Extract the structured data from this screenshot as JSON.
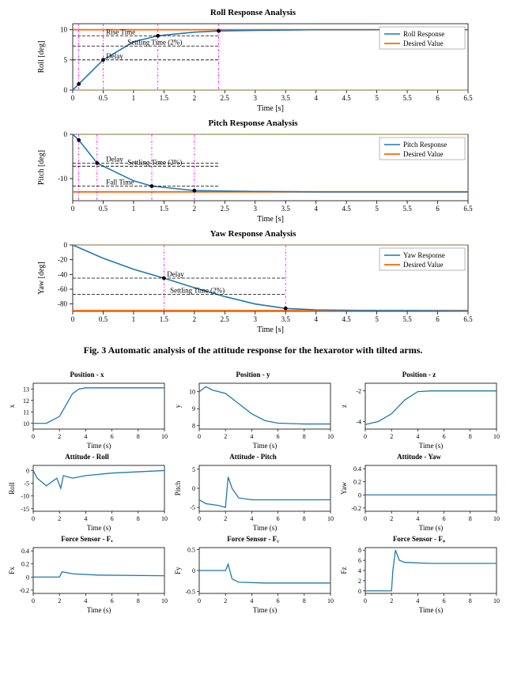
{
  "caption": "Fig. 3   Automatic analysis of the attitude response for the hexarotor with tilted arms.",
  "top_charts": [
    {
      "title": "Roll Response Analysis",
      "ylabel": "Roll [deg]",
      "xlabel": "Time [s]",
      "legend": [
        "Roll Response",
        "Desired Value"
      ],
      "annotations": [
        "Rise Time",
        "Delay",
        "Settling Time (2%)"
      ]
    },
    {
      "title": "Pitch Response Analysis",
      "ylabel": "Pitch [deg]",
      "xlabel": "Time [s]",
      "legend": [
        "Pitch Response",
        "Desired Value"
      ],
      "annotations": [
        "Delay",
        "Settling Time (2%)",
        "Fall Time"
      ]
    },
    {
      "title": "Yaw Response Analysis",
      "ylabel": "Yaw [deg]",
      "xlabel": "Time [s]",
      "legend": [
        "Yaw Response",
        "Desired Value"
      ],
      "annotations": [
        "Delay",
        "Settling Time (2%)"
      ]
    }
  ],
  "small_charts": [
    {
      "title": "Position - x",
      "ylabel": "x",
      "xlabel": "Time (s)"
    },
    {
      "title": "Position - y",
      "ylabel": "y",
      "xlabel": "Time (s)"
    },
    {
      "title": "Position - z",
      "ylabel": "z",
      "xlabel": "Time (s)"
    },
    {
      "title": "Attitude - Roll",
      "ylabel": "Roll",
      "xlabel": "Time (s)"
    },
    {
      "title": "Attitude - Pitch",
      "ylabel": "Pitch",
      "xlabel": "Time (s)"
    },
    {
      "title": "Attitude - Yaw",
      "ylabel": "Yaw",
      "xlabel": "Time (s)"
    },
    {
      "title": "Force Sensor - Fₓ",
      "ylabel": "Fₓ",
      "xlabel": "Time (s)"
    },
    {
      "title": "Force Sensor - Fᵧ",
      "ylabel": "Fᵧ",
      "xlabel": "Time (s)"
    },
    {
      "title": "Force Sensor - Fᵩ",
      "ylabel": "Fᵩ",
      "xlabel": "Time (s)"
    }
  ],
  "chart_data": [
    {
      "name": "Roll Response Analysis",
      "type": "line",
      "xlabel": "Time [s]",
      "ylabel": "Roll [deg]",
      "xlim": [
        0,
        6.5
      ],
      "ylim": [
        0,
        11
      ],
      "xticks": [
        0,
        0.5,
        1,
        1.5,
        2,
        2.5,
        3,
        3.5,
        4,
        4.5,
        5,
        5.5,
        6,
        6.5
      ],
      "yticks": [
        0,
        5,
        10
      ],
      "series": [
        {
          "name": "Roll Response",
          "x": [
            0,
            0.1,
            0.5,
            1.0,
            1.4,
            2.0,
            2.4,
            3.0,
            4.0,
            6.5
          ],
          "y": [
            0,
            1.0,
            5.0,
            8.0,
            9.0,
            9.6,
            9.8,
            9.9,
            10.0,
            10.0
          ]
        },
        {
          "name": "Desired Value",
          "x": [
            0,
            6.5
          ],
          "y": [
            10,
            10
          ]
        }
      ],
      "markers": [
        {
          "x": 0.1,
          "y": 1.0
        },
        {
          "x": 0.5,
          "y": 5.0
        },
        {
          "x": 1.4,
          "y": 9.0
        },
        {
          "x": 2.4,
          "y": 9.8
        }
      ],
      "vertical_markers_x": [
        0.1,
        0.5,
        1.4,
        2.4
      ],
      "h_annotations": [
        {
          "y": 9.0,
          "label": "Rise Time"
        },
        {
          "y": 5.0,
          "label": "Delay"
        },
        {
          "y": 7.3,
          "label": "Settling Time (2%)"
        }
      ]
    },
    {
      "name": "Pitch Response Analysis",
      "type": "line",
      "xlabel": "Time [s]",
      "ylabel": "Pitch [deg]",
      "xlim": [
        0,
        6.5
      ],
      "ylim": [
        -15,
        0
      ],
      "xticks": [
        0,
        0.5,
        1,
        1.5,
        2,
        2.5,
        3,
        3.5,
        4,
        4.5,
        5,
        5.5,
        6,
        6.5
      ],
      "yticks": [
        -10,
        0
      ],
      "series": [
        {
          "name": "Pitch Response",
          "x": [
            0,
            0.1,
            0.4,
            1.0,
            1.3,
            2.0,
            3.0,
            4.0,
            6.5
          ],
          "y": [
            0,
            -1.3,
            -6.5,
            -10.5,
            -11.7,
            -12.7,
            -12.9,
            -13.0,
            -13.0
          ]
        },
        {
          "name": "Desired Value",
          "x": [
            0,
            6.5
          ],
          "y": [
            -13,
            -13
          ]
        }
      ],
      "markers": [
        {
          "x": 0.1,
          "y": -1.3
        },
        {
          "x": 0.4,
          "y": -6.5
        },
        {
          "x": 1.3,
          "y": -11.7
        },
        {
          "x": 2.0,
          "y": -12.7
        }
      ],
      "vertical_markers_x": [
        0.1,
        0.4,
        1.3,
        2.0
      ],
      "h_annotations": [
        {
          "y": -6.5,
          "label": "Delay"
        },
        {
          "y": -7.2,
          "label": "Settling Time (2%)"
        },
        {
          "y": -11.7,
          "label": "Fall Time"
        }
      ]
    },
    {
      "name": "Yaw Response Analysis",
      "type": "line",
      "xlabel": "Time [s]",
      "ylabel": "Yaw [deg]",
      "xlim": [
        0,
        6.5
      ],
      "ylim": [
        -90,
        0
      ],
      "xticks": [
        0,
        0.5,
        1,
        1.5,
        2,
        2.5,
        3,
        3.5,
        4,
        4.5,
        5,
        5.5,
        6,
        6.5
      ],
      "yticks": [
        -80,
        -60,
        -40,
        -20,
        0
      ],
      "series": [
        {
          "name": "Yaw Response",
          "x": [
            0,
            0.5,
            1.0,
            1.5,
            2.0,
            2.5,
            3.0,
            3.5,
            4.0,
            5.0,
            6.5
          ],
          "y": [
            0,
            -18,
            -33,
            -45,
            -58,
            -70,
            -80,
            -86,
            -88,
            -89,
            -89.5
          ]
        },
        {
          "name": "Desired Value",
          "x": [
            0,
            6.5
          ],
          "y": [
            -89,
            -89
          ]
        }
      ],
      "markers": [
        {
          "x": 1.5,
          "y": -45
        },
        {
          "x": 3.5,
          "y": -86
        }
      ],
      "vertical_markers_x": [
        1.5,
        3.5
      ],
      "h_annotations": [
        {
          "y": -45,
          "label": "Delay"
        },
        {
          "y": -67,
          "label": "Settling Time (2%)"
        }
      ]
    },
    {
      "name": "Position - x",
      "type": "line",
      "xlabel": "Time (s)",
      "ylabel": "x",
      "xlim": [
        0,
        10
      ],
      "ylim": [
        9.5,
        13.5
      ],
      "xticks": [
        0,
        2,
        4,
        6,
        8,
        10
      ],
      "yticks": [
        10,
        11,
        12,
        13
      ],
      "series": [
        {
          "name": "x",
          "x": [
            0,
            1,
            2,
            3,
            3.5,
            4,
            10
          ],
          "y": [
            10,
            10,
            10.6,
            12.6,
            13.0,
            13.1,
            13.1
          ]
        }
      ]
    },
    {
      "name": "Position - y",
      "type": "line",
      "xlabel": "Time (s)",
      "ylabel": "y",
      "xlim": [
        0,
        10
      ],
      "ylim": [
        7.8,
        10.5
      ],
      "xticks": [
        0,
        2,
        4,
        6,
        8,
        10
      ],
      "yticks": [
        8,
        9,
        10
      ],
      "series": [
        {
          "name": "y",
          "x": [
            0,
            0.5,
            1,
            2,
            3,
            4,
            5,
            6,
            8,
            10
          ],
          "y": [
            10,
            10.3,
            10.1,
            9.9,
            9.3,
            8.7,
            8.3,
            8.15,
            8.1,
            8.1
          ]
        }
      ]
    },
    {
      "name": "Position - z",
      "type": "line",
      "xlabel": "Time (s)",
      "ylabel": "z",
      "xlim": [
        0,
        10
      ],
      "ylim": [
        -4.5,
        -1.5
      ],
      "xticks": [
        0,
        2,
        4,
        6,
        8,
        10
      ],
      "yticks": [
        -4,
        -2
      ],
      "series": [
        {
          "name": "z",
          "x": [
            0,
            1,
            2,
            3,
            4,
            5,
            10
          ],
          "y": [
            -4.2,
            -4.0,
            -3.5,
            -2.6,
            -2.05,
            -2.0,
            -2.0
          ]
        }
      ]
    },
    {
      "name": "Attitude - Roll",
      "type": "line",
      "xlabel": "Time (s)",
      "ylabel": "Roll",
      "xlim": [
        0,
        10
      ],
      "ylim": [
        -16,
        2
      ],
      "xticks": [
        0,
        2,
        4,
        6,
        8,
        10
      ],
      "yticks": [
        -15,
        -10,
        -5,
        0
      ],
      "series": [
        {
          "name": "Roll",
          "x": [
            0,
            0.3,
            1,
            1.8,
            2.1,
            2.3,
            3,
            4,
            6,
            10
          ],
          "y": [
            0,
            -3,
            -6,
            -3,
            -7,
            -2,
            -3,
            -2,
            -1,
            0
          ]
        }
      ]
    },
    {
      "name": "Attitude - Pitch",
      "type": "line",
      "xlabel": "Time (s)",
      "ylabel": "Pitch",
      "xlim": [
        0,
        10
      ],
      "ylim": [
        -6,
        6
      ],
      "xticks": [
        0,
        2,
        4,
        6,
        8,
        10
      ],
      "yticks": [
        -5,
        0,
        5
      ],
      "series": [
        {
          "name": "Pitch",
          "x": [
            0,
            0.5,
            1.5,
            2.0,
            2.2,
            2.5,
            3,
            4,
            6,
            10
          ],
          "y": [
            -3,
            -4,
            -4.5,
            -5,
            3,
            0,
            -2.5,
            -3,
            -3,
            -3
          ]
        }
      ]
    },
    {
      "name": "Attitude - Yaw",
      "type": "line",
      "xlabel": "Time (s)",
      "ylabel": "Yaw",
      "xlim": [
        0,
        10
      ],
      "ylim": [
        -0.25,
        0.45
      ],
      "xticks": [
        0,
        2,
        4,
        6,
        8,
        10
      ],
      "yticks": [
        -0.2,
        0,
        0.2,
        0.4
      ],
      "series": [
        {
          "name": "Yaw",
          "x": [
            0,
            0.2,
            1,
            2,
            4,
            10
          ],
          "y": [
            0,
            0,
            0,
            0,
            0,
            0
          ]
        }
      ]
    },
    {
      "name": "Force Sensor - Fx",
      "type": "line",
      "xlabel": "Time (s)",
      "ylabel": "Fx",
      "xlim": [
        0,
        10
      ],
      "ylim": [
        -0.25,
        0.45
      ],
      "xticks": [
        0,
        2,
        4,
        6,
        8,
        10
      ],
      "yticks": [
        -0.2,
        0,
        0.2,
        0.4
      ],
      "series": [
        {
          "name": "Fx",
          "x": [
            0,
            1,
            2,
            2.2,
            3,
            5,
            10
          ],
          "y": [
            0,
            0,
            0,
            0.08,
            0.05,
            0.03,
            0.02
          ]
        }
      ]
    },
    {
      "name": "Force Sensor - Fy",
      "type": "line",
      "xlabel": "Time (s)",
      "ylabel": "Fy",
      "xlim": [
        0,
        10
      ],
      "ylim": [
        -0.55,
        0.55
      ],
      "xticks": [
        0,
        2,
        4,
        6,
        8,
        10
      ],
      "yticks": [
        -0.5,
        0,
        0.5
      ],
      "series": [
        {
          "name": "Fy",
          "x": [
            0,
            2,
            2.2,
            2.5,
            3,
            5,
            10
          ],
          "y": [
            0,
            0,
            0.15,
            -0.2,
            -0.28,
            -0.3,
            -0.3
          ]
        }
      ]
    },
    {
      "name": "Force Sensor - Fz",
      "type": "line",
      "xlabel": "Time (s)",
      "ylabel": "Fz",
      "xlim": [
        0,
        10
      ],
      "ylim": [
        -0.5,
        8.5
      ],
      "xticks": [
        0,
        2,
        4,
        6,
        8,
        10
      ],
      "yticks": [
        0,
        2,
        4,
        6,
        8
      ],
      "series": [
        {
          "name": "Fz",
          "x": [
            0,
            2,
            2.1,
            2.3,
            2.6,
            3,
            5,
            10
          ],
          "y": [
            0,
            0,
            4,
            8,
            6,
            5.6,
            5.4,
            5.4
          ]
        }
      ]
    }
  ]
}
